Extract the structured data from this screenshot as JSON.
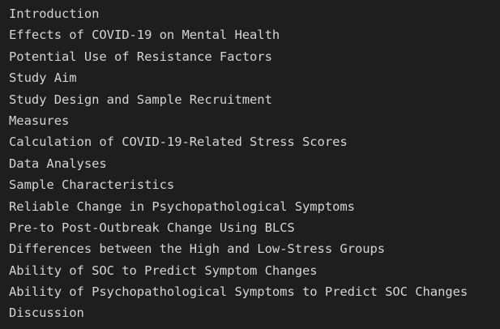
{
  "outline": {
    "items": [
      "Introduction",
      "Effects of COVID-19 on Mental Health",
      "Potential Use of Resistance Factors",
      "Study Aim",
      "Study Design and Sample Recruitment",
      "Measures",
      "Calculation of COVID-19-Related Stress Scores",
      "Data Analyses",
      "Sample Characteristics",
      "Reliable Change in Psychopathological Symptoms",
      "Pre-to Post-Outbreak Change Using BLCS",
      "Differences between the High and Low-Stress Groups",
      "Ability of SOC to Predict Symptom Changes",
      "Ability of Psychopathological Symptoms to Predict SOC Changes",
      "Discussion"
    ]
  },
  "colors": {
    "background": "#1e1e1e",
    "text": "#d4d4d4"
  }
}
